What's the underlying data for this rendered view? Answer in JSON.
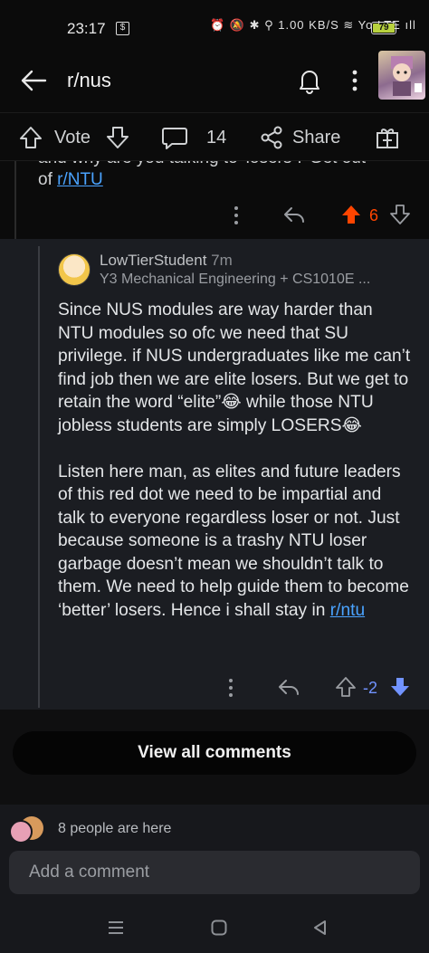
{
  "status_bar": {
    "time": "23:17",
    "icons_text": "⏰ 🔕 ✱ ⚲ 1.00 KB/S ≋ Yo LTE ıll",
    "battery": "79"
  },
  "header": {
    "title": "r/nus"
  },
  "post_actions": {
    "vote_label": "Vote",
    "comment_count": "14",
    "share_label": "Share"
  },
  "parent_comment": {
    "clipped_line": "and why are you talking to 'losers'? Get out",
    "text_prefix": "of ",
    "link": "r/NTU",
    "score": "6"
  },
  "reply": {
    "username": "LowTierStudent",
    "age": "7m",
    "flair": "Y3 Mechanical Engineering + CS1010E ...",
    "paragraphs": [
      "Since NUS modules are way harder than NTU modules so ofc we need that SU privilege. if NUS undergraduates like me can’t find job then we are elite losers. But we get to retain the word “elite”😂 while those NTU jobless students are simply LOSERS😂",
      "Listen here man, as elites and future leaders of this red dot we need to be impartial and talk to everyone regardless loser or not. Just because someone is a trashy NTU loser garbage doesn’t mean we shouldn’t talk to them. We need to help guide them to become ‘better’ losers. Hence i shall stay in "
    ],
    "link": "r/ntu",
    "score": "-2"
  },
  "view_all_label": "View all comments",
  "presence_text": "8 people are here",
  "add_comment_placeholder": "Add a comment",
  "colors": {
    "upvote": "#ff4500",
    "downvote": "#7193ff",
    "link": "#4aa3ff",
    "reply_bg": "#1b1d22"
  }
}
